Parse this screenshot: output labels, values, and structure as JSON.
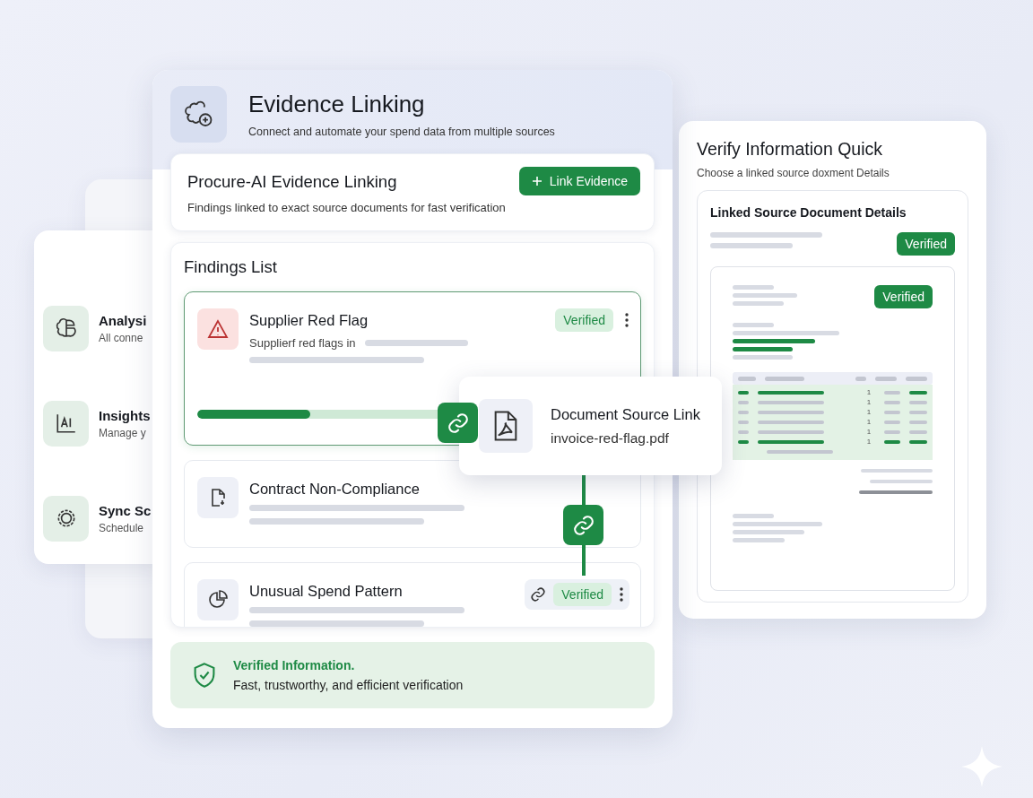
{
  "header": {
    "title": "Evidence Linking",
    "subtitle": "Connect and automate your spend data from multiple sources"
  },
  "side_panel": {
    "items": [
      {
        "title": "Analysi",
        "subtitle": "All conne"
      },
      {
        "title": "Insights",
        "subtitle": "Manage y"
      },
      {
        "title": "Sync Sc",
        "subtitle": "Schedule"
      }
    ]
  },
  "intro_card": {
    "title": "Procure-AI Evidence Linking",
    "subtitle": "Findings linked to exact source documents for fast verification",
    "button": "Link Evidence"
  },
  "findings": {
    "title": "Findings List",
    "items": [
      {
        "kind": "warning",
        "title": "Supplier Red Flag",
        "subtitle": "Supplierf red flags in",
        "badge": "Verified",
        "linked": false,
        "selected": true,
        "level": 0.42
      },
      {
        "kind": "document",
        "title": "Contract Non-Compliance",
        "linked": false,
        "selected": false
      },
      {
        "kind": "pie",
        "title": "Unusual Spend Pattern",
        "badge": "Verified",
        "linked": true,
        "selected": false
      }
    ]
  },
  "link_popover": {
    "title": "Document Source Link",
    "file": "invoice-red-flag.pdf"
  },
  "footer": {
    "title": "Verified Information.",
    "text": "Fast, trustworthy, and efficient verification"
  },
  "verify_panel": {
    "title": "Verify Information Quick",
    "subtitle": "Choose a linked source doxment Details",
    "card_title": "Linked Source Document Details",
    "badge": "Verified",
    "document_badge": "Verified",
    "rows": [
      {
        "qty": "1",
        "accent": true
      },
      {
        "qty": "1",
        "accent": false
      },
      {
        "qty": "1",
        "accent": false
      },
      {
        "qty": "1",
        "accent": false
      },
      {
        "qty": "1",
        "accent": false
      },
      {
        "qty": "1",
        "accent": true
      }
    ]
  }
}
